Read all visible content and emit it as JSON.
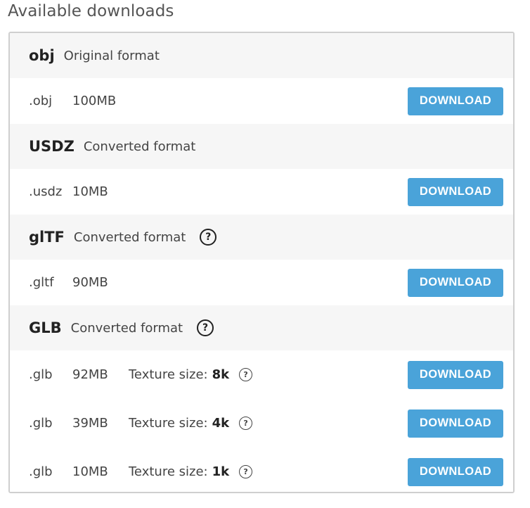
{
  "heading": "Available downloads",
  "button_label": "DOWNLOAD",
  "colors": {
    "button": "#4aa3d9",
    "header_bg": "#f6f6f6",
    "border": "#cfcfcf"
  },
  "formats": [
    {
      "name": "obj",
      "description": "Original format",
      "help_icon": false,
      "files": [
        {
          "ext": ".obj",
          "size": "100MB"
        }
      ]
    },
    {
      "name": "USDZ",
      "description": "Converted format",
      "help_icon": false,
      "files": [
        {
          "ext": ".usdz",
          "size": "10MB"
        }
      ]
    },
    {
      "name": "glTF",
      "description": "Converted format",
      "help_icon": true,
      "files": [
        {
          "ext": ".gltf",
          "size": "90MB"
        }
      ]
    },
    {
      "name": "GLB",
      "description": "Converted format",
      "help_icon": true,
      "files": [
        {
          "ext": ".glb",
          "size": "92MB",
          "texture_label": "Texture size:",
          "texture_value": "8k"
        },
        {
          "ext": ".glb",
          "size": "39MB",
          "texture_label": "Texture size:",
          "texture_value": "4k"
        },
        {
          "ext": ".glb",
          "size": "10MB",
          "texture_label": "Texture size:",
          "texture_value": "1k"
        }
      ]
    }
  ]
}
